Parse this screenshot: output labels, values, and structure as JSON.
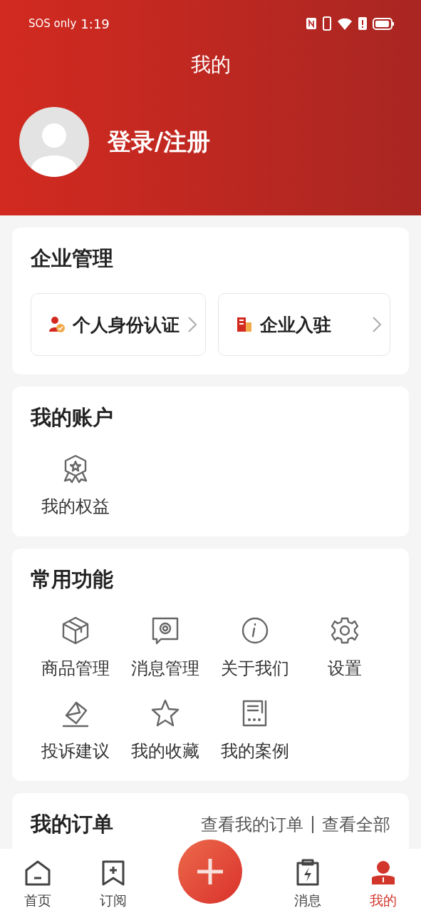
{
  "status_bar": {
    "carrier": "SOS only",
    "time": "1:19"
  },
  "header": {
    "title": "我的",
    "login": "登录/注册"
  },
  "enterprise": {
    "title": "企业管理",
    "actions": [
      {
        "kind": "identity",
        "label": "个人身份认证"
      },
      {
        "kind": "company",
        "label": "企业入驻"
      }
    ]
  },
  "account": {
    "title": "我的账户",
    "items": [
      {
        "kind": "badge",
        "label": "我的权益"
      }
    ]
  },
  "functions": {
    "title": "常用功能",
    "items": [
      {
        "kind": "box",
        "label": "商品管理"
      },
      {
        "kind": "message",
        "label": "消息管理"
      },
      {
        "kind": "info",
        "label": "关于我们"
      },
      {
        "kind": "gear",
        "label": "设置"
      },
      {
        "kind": "complaint",
        "label": "投诉建议"
      },
      {
        "kind": "star",
        "label": "我的收藏"
      },
      {
        "kind": "cases",
        "label": "我的案例"
      }
    ]
  },
  "orders": {
    "title": "我的订单",
    "links": [
      "查看我的订单",
      "查看全部"
    ]
  },
  "nav": [
    {
      "kind": "home",
      "label": "首页",
      "selected": false
    },
    {
      "kind": "subscribe",
      "label": "订阅",
      "selected": false
    },
    {
      "kind": "add"
    },
    {
      "kind": "message",
      "label": "消息",
      "selected": false
    },
    {
      "kind": "me",
      "label": "我的",
      "selected": true
    }
  ]
}
